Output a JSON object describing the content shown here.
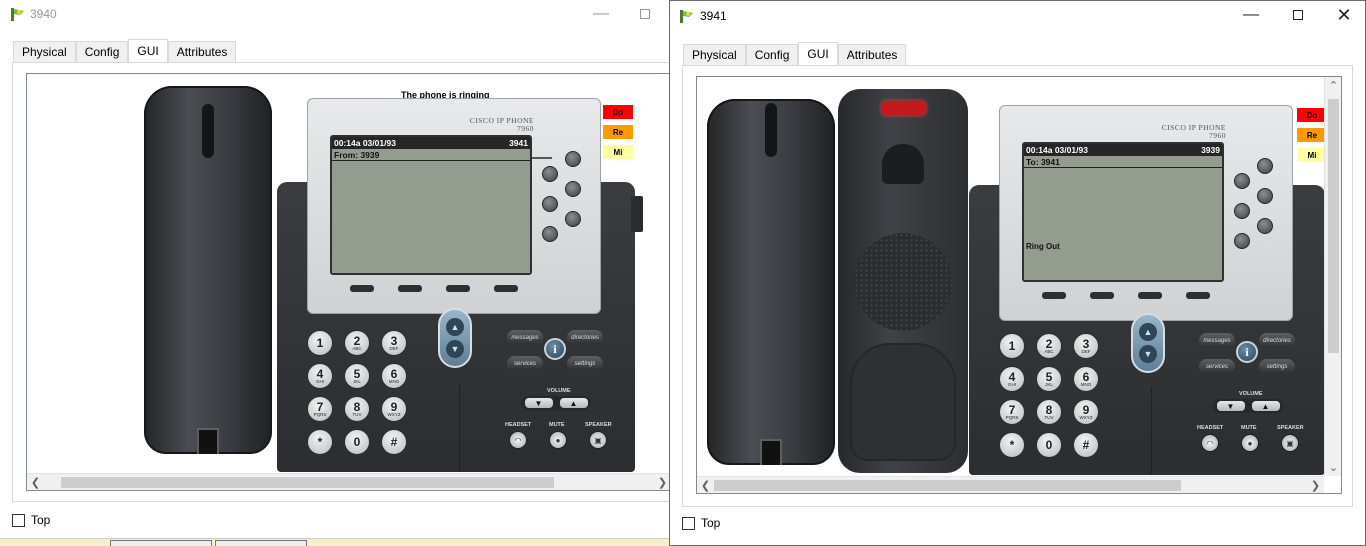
{
  "colors": {
    "dnd": "#ff0000",
    "redial": "#ff9900",
    "mi": "#ffffa0",
    "led": "#c3191c"
  },
  "window_left": {
    "title": "3940",
    "tabs": [
      "Physical",
      "Config",
      "GUI",
      "Attributes"
    ],
    "active_tab": "GUI",
    "ring_message": "The phone is ringing",
    "side_buttons": [
      "Do",
      "Re",
      "Mi"
    ],
    "phone": {
      "brand_line1": "CISCO IP PHONE",
      "brand_line2": "7960",
      "time": "00:14a 03/01/93",
      "extension": "3941",
      "line1": "From: 3939",
      "status": ""
    },
    "top_checkbox": "Top"
  },
  "window_right": {
    "title": "3941",
    "tabs": [
      "Physical",
      "Config",
      "GUI",
      "Attributes"
    ],
    "active_tab": "GUI",
    "side_buttons": [
      "Do",
      "Re",
      "Mi"
    ],
    "phone": {
      "brand_line1": "CISCO IP PHONE",
      "brand_line2": "7960",
      "time": "00:14a 03/01/93",
      "extension": "3939",
      "line1": "To: 3941",
      "status": "Ring Out"
    },
    "top_checkbox": "Top"
  },
  "keypad": [
    {
      "d": "1",
      "l": ""
    },
    {
      "d": "2",
      "l": "ABC"
    },
    {
      "d": "3",
      "l": "DEF"
    },
    {
      "d": "4",
      "l": "GHI"
    },
    {
      "d": "5",
      "l": "JKL"
    },
    {
      "d": "6",
      "l": "MNO"
    },
    {
      "d": "7",
      "l": "PQRS"
    },
    {
      "d": "8",
      "l": "TUV"
    },
    {
      "d": "9",
      "l": "WXYZ"
    },
    {
      "d": "*",
      "l": ""
    },
    {
      "d": "0",
      "l": ""
    },
    {
      "d": "#",
      "l": ""
    }
  ],
  "function_keys": {
    "messages": "messages",
    "directories": "directories",
    "services": "services",
    "settings": "settings",
    "info": "i"
  },
  "labels": {
    "volume": "VOLUME",
    "headset": "HEADSET",
    "mute": "MUTE",
    "speaker": "SPEAKER"
  }
}
